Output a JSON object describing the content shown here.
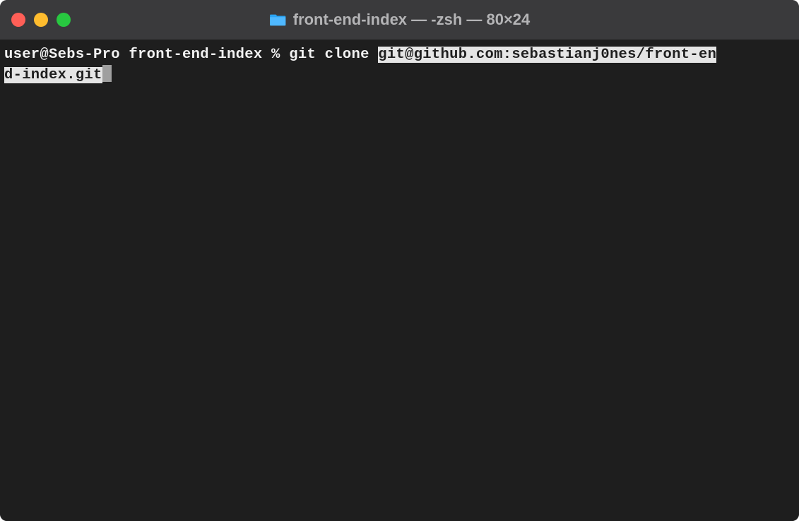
{
  "titlebar": {
    "folder_icon": "folder-icon",
    "title": "front-end-index — -zsh — 80×24"
  },
  "terminal": {
    "prompt": "user@Sebs-Pro front-end-index % ",
    "command": "git clone ",
    "highlighted_url_part1": "git@github.com:sebastianj0nes/front-en",
    "highlighted_url_part2": "d-index.git"
  }
}
